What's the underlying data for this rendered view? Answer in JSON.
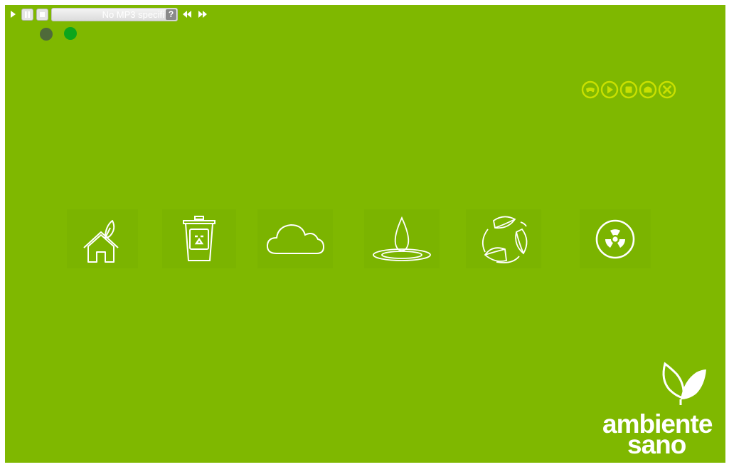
{
  "player": {
    "buttons": [
      {
        "icon": "play-icon"
      },
      {
        "icon": "pause-icon"
      },
      {
        "icon": "stop-icon"
      }
    ],
    "track_text": "No MP3 specifi",
    "help_label": "?",
    "skip": [
      {
        "icon": "rewind-icon"
      },
      {
        "icon": "fast-forward-icon"
      }
    ]
  },
  "status_dots": [
    {
      "color": "#4f6a3a"
    },
    {
      "color": "#0da61c"
    }
  ],
  "nav": {
    "color": "#c9e000",
    "buttons": [
      {
        "icon": "gamepad-icon"
      },
      {
        "icon": "play-icon"
      },
      {
        "icon": "stop-icon"
      },
      {
        "icon": "home-icon"
      },
      {
        "icon": "close-icon"
      }
    ]
  },
  "tiles": [
    {
      "icon": "eco-house-icon"
    },
    {
      "icon": "recycle-bin-icon"
    },
    {
      "icon": "cloud-icon"
    },
    {
      "icon": "water-drop-icon"
    },
    {
      "icon": "recycle-leaves-icon"
    },
    {
      "icon": "radiation-icon"
    }
  ],
  "logo": {
    "line1": "ambiente",
    "line2": "sano"
  },
  "colors": {
    "background": "#7fb800",
    "accent": "#c9e000"
  }
}
